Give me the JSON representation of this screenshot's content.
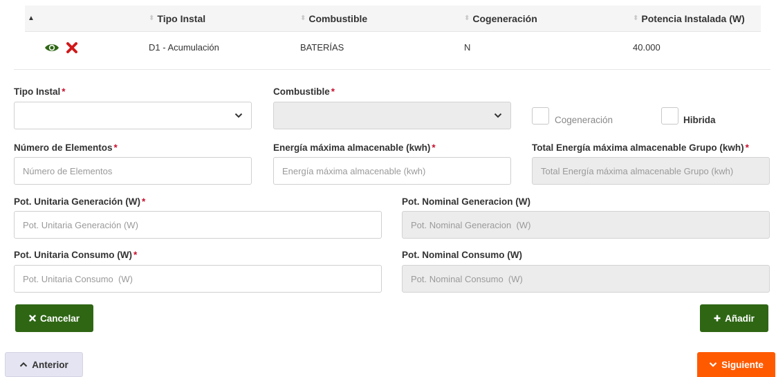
{
  "table": {
    "columns": [
      "",
      "Tipo Instal",
      "Combustible",
      "Cogeneración",
      "Potencia Instalada (W)"
    ],
    "rows": [
      {
        "tipo_instal": "D1 - Acumulación",
        "combustible": "BATERÍAS",
        "cogeneracion": "N",
        "potencia": "40.000"
      }
    ]
  },
  "form": {
    "tipo_instal": {
      "label": "Tipo Instal",
      "value": ""
    },
    "combustible": {
      "label": "Combustible",
      "value": ""
    },
    "cogeneracion": {
      "label": "Cogeneración",
      "checked": false
    },
    "hibrida": {
      "label": "Hibrida",
      "checked": false
    },
    "numero_elementos": {
      "label": "Número de Elementos",
      "placeholder": "Número de Elementos"
    },
    "energia_maxima": {
      "label": "Energía máxima almacenable (kwh)",
      "placeholder": "Energía máxima almacenable (kwh)"
    },
    "total_energia": {
      "label": "Total Energía máxima almacenable Grupo (kwh)",
      "placeholder": "Total Energía máxima almacenable Grupo (kwh)"
    },
    "pot_unit_gen": {
      "label": "Pot. Unitaria Generación (W)",
      "placeholder": "Pot. Unitaria Generación (W)"
    },
    "pot_nom_gen": {
      "label": "Pot. Nominal Generacion (W)",
      "placeholder": "Pot. Nominal Generacion  (W)"
    },
    "pot_unit_cons": {
      "label": "Pot. Unitaria Consumo (W)",
      "placeholder": "Pot. Unitaria Consumo  (W)"
    },
    "pot_nom_cons": {
      "label": "Pot. Nominal Consumo (W)",
      "placeholder": "Pot. Nominal Consumo  (W)"
    },
    "required_mark": "*"
  },
  "buttons": {
    "cancelar": "Cancelar",
    "anadir": "Añadir",
    "anterior": "Anterior",
    "siguiente": "Siguiente"
  },
  "colors": {
    "primary_green": "#2e6614",
    "next_orange": "#ff5a00",
    "required_red": "#c8102e",
    "delete_red": "#d0191a"
  },
  "icons": [
    "eye-icon",
    "delete-x-icon",
    "chevron-down-icon",
    "times-icon",
    "plus-icon",
    "chevron-up-icon",
    "sort-icon",
    "sort-asc-icon"
  ]
}
